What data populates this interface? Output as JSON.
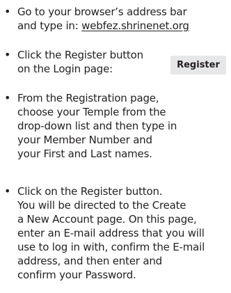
{
  "instructions": [
    {
      "bullet": "•",
      "lines": [
        "Go to your browser’s address bar",
        "and type in: "
      ],
      "link_text": "webfez.shrinenet.org"
    },
    {
      "bullet": "•",
      "lines": [
        "Click the Register button",
        "on the Login page:"
      ]
    },
    {
      "bullet": "•",
      "lines": [
        "From the Registration page,",
        "choose your Temple from the",
        "drop-down list and then type in",
        "your Member Number and",
        "your First and Last names."
      ]
    },
    {
      "bullet": "•",
      "lines": [
        "Click on the Register button.",
        "You will be directed to the Create",
        "a New Account page. On this page,",
        "enter an E-mail address that you will",
        "use to log in with, confirm the E-mail",
        "address, and then enter and",
        "confirm your Password."
      ]
    }
  ],
  "register_button": {
    "label": "Register",
    "background": "#e6e7e8"
  }
}
